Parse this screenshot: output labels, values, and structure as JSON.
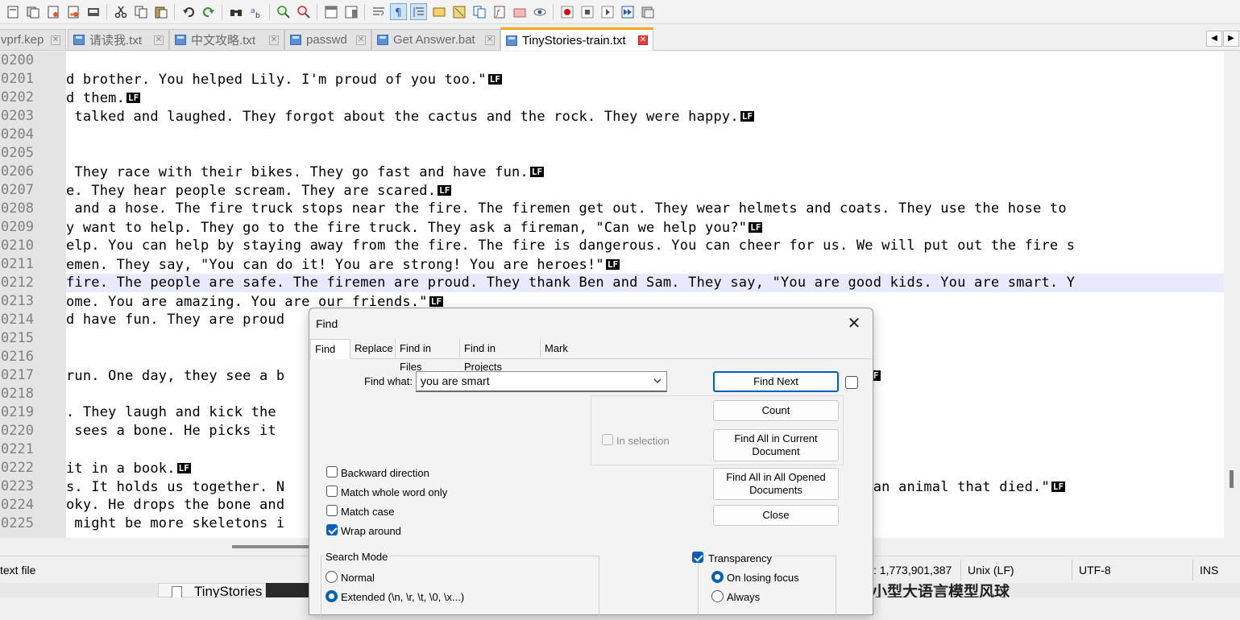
{
  "toolbar": {
    "icons": [
      "new-file-icon",
      "open-file-icon",
      "save-icon",
      "save-all-icon",
      "close-icon",
      "close-all-icon",
      "print-icon",
      "cut-icon",
      "copy-icon",
      "paste-icon",
      "undo-icon",
      "redo-icon",
      "find-icon",
      "replace-icon",
      "zoom-in-icon",
      "zoom-out-icon",
      "sync-vertical-icon",
      "sync-horizontal-icon",
      "word-wrap-icon",
      "show-all-chars-icon",
      "indent-guide-icon",
      "define-language-icon",
      "document-map-icon",
      "document-list-icon",
      "function-list-icon",
      "folder-as-workspace-icon",
      "monitoring-icon",
      "record-macro-icon",
      "stop-record-icon",
      "play-macro-icon",
      "run-macro-multiple-icon",
      "save-macro-icon"
    ]
  },
  "tabs": [
    {
      "label": "vprf.kep"
    },
    {
      "label": "请读我.txt"
    },
    {
      "label": "中文攻略.txt"
    },
    {
      "label": "passwd"
    },
    {
      "label": "Get Answer.bat"
    },
    {
      "label": "TinyStories-train.txt"
    }
  ],
  "tab_nav": {
    "left": "◀",
    "right": "▶"
  },
  "lf_marker": "LF",
  "editor": {
    "lines": [
      {
        "num": "0200",
        "text": "",
        "lf": false
      },
      {
        "num": "0201",
        "text": "d brother. You helped Lily. I'm proud of you too.\"",
        "lf": true
      },
      {
        "num": "0202",
        "text": "d them.",
        "lf": true
      },
      {
        "num": "0203",
        "text": " talked and laughed. They forgot about the cactus and the rock. They were happy.",
        "lf": true
      },
      {
        "num": "0204",
        "text": "",
        "lf": false
      },
      {
        "num": "0205",
        "text": "",
        "lf": false
      },
      {
        "num": "0206",
        "text": " They race with their bikes. They go fast and have fun.",
        "lf": true
      },
      {
        "num": "0207",
        "text": "e. They hear people scream. They are scared.",
        "lf": true
      },
      {
        "num": "0208",
        "text": " and a hose. The fire truck stops near the fire. The firemen get out. They wear helmets and coats. They use the hose to",
        "lf": false
      },
      {
        "num": "0209",
        "text": "y want to help. They go to the fire truck. They ask a fireman, \"Can we help you?\"",
        "lf": true
      },
      {
        "num": "0210",
        "text": "elp. You can help by staying away from the fire. The fire is dangerous. You can cheer for us. We will put out the fire s",
        "lf": false
      },
      {
        "num": "0211",
        "text": "emen. They say, \"You can do it! You are strong! You are heroes!\"",
        "lf": true
      },
      {
        "num": "0212",
        "text": "fire. The people are safe. The firemen are proud. They thank Ben and Sam. They say, \"You are good kids. You are smart. Y",
        "lf": false
      },
      {
        "num": "0213",
        "text": "ome. You are amazing. You are our friends.\"",
        "lf": true
      },
      {
        "num": "0214",
        "text": "d have fun. They are proud",
        "lf": false
      },
      {
        "num": "0215",
        "text": "",
        "lf": false
      },
      {
        "num": "0216",
        "text": "",
        "lf": false
      },
      {
        "num": "0217",
        "text": "run. One day, they see a b                                                            ke noise.",
        "lf": true
      },
      {
        "num": "0218",
        "text": "",
        "lf": false
      },
      {
        "num": "0219",
        "text": ". They laugh and kick the",
        "lf": false
      },
      {
        "num": "0220",
        "text": " sees a bone. He picks it",
        "lf": false
      },
      {
        "num": "0221",
        "text": "",
        "lf": false
      },
      {
        "num": "0222",
        "text": "it in a book.",
        "lf": true
      },
      {
        "num": "0223",
        "text": "s. It holds us together. N                                                            be it was an animal that died.\"",
        "lf": true
      },
      {
        "num": "0224",
        "text": "oky. He drops the bone and",
        "lf": false
      },
      {
        "num": "0225",
        "text": " might be more skeletons i",
        "lf": false
      }
    ],
    "highlighted_line": "0212"
  },
  "statusbar": {
    "file_type": "text file",
    "length": ": 1,773,901,387",
    "eol": "Unix (LF)",
    "encoding": "UTF-8",
    "mode": "INS"
  },
  "taskbar": {
    "item": "TinyStories",
    "cjk_text": "小型大语言模型风球"
  },
  "find_dialog": {
    "title": "Find",
    "close_symbol": "✕",
    "tabs": [
      "Find",
      "Replace",
      "Find in Files",
      "Find in Projects",
      "Mark"
    ],
    "active_tab": "Find",
    "find_what_label": "Find what:",
    "find_what_value": "you are smart",
    "buttons": {
      "find_next": "Find Next",
      "count": "Count",
      "find_all_current": "Find All in Current Document",
      "find_all_opened": "Find All in All Opened Documents",
      "close": "Close"
    },
    "in_selection": "In selection",
    "options": [
      {
        "label": "Backward direction",
        "checked": false
      },
      {
        "label": "Match whole word only",
        "checked": false
      },
      {
        "label": "Match case",
        "checked": false
      },
      {
        "label": "Wrap around",
        "checked": true
      }
    ],
    "search_mode": {
      "title": "Search Mode",
      "options": [
        {
          "label": "Normal",
          "selected": false
        },
        {
          "label": "Extended (\\n, \\r, \\t, \\0, \\x...)",
          "selected": true
        }
      ]
    },
    "transparency": {
      "label": "Transparency",
      "checked": true,
      "options": [
        {
          "label": "On losing focus",
          "selected": true
        },
        {
          "label": "Always",
          "selected": false
        }
      ]
    }
  }
}
